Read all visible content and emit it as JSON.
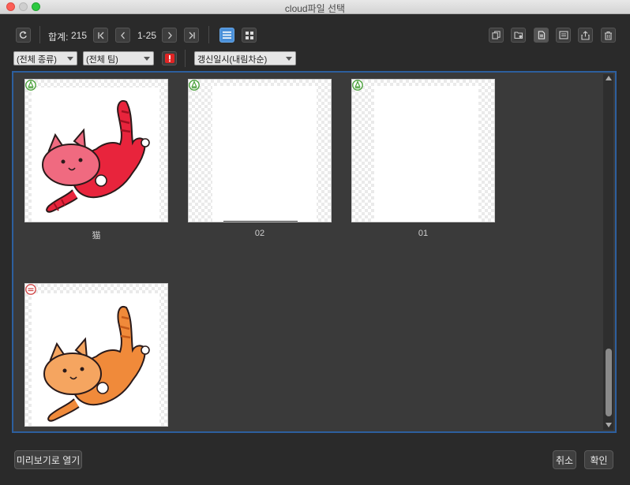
{
  "window": {
    "title": "cloud파일 선택"
  },
  "toolbar": {
    "total_label": "합계:",
    "total_value": "215",
    "range": "1-25"
  },
  "filters": {
    "type": "(전체 종류)",
    "team": "(전체 팀)",
    "sort": "갱신일시(내림차순)"
  },
  "files": [
    {
      "name": "猫",
      "badge": "pen-icon"
    },
    {
      "name": "02",
      "badge": "pen-icon"
    },
    {
      "name": "01",
      "badge": "pen-icon"
    },
    {
      "name": "",
      "badge": "stamp-icon"
    }
  ],
  "footer": {
    "preview_label": "미리보기로 열기",
    "cancel_label": "취소",
    "ok_label": "확인"
  },
  "colors": {
    "accent": "#4a90d9",
    "panel_border": "#2d5f9e",
    "warning": "#e02424",
    "cat_red": "#e8243c",
    "cat_orange": "#f08a3a"
  }
}
